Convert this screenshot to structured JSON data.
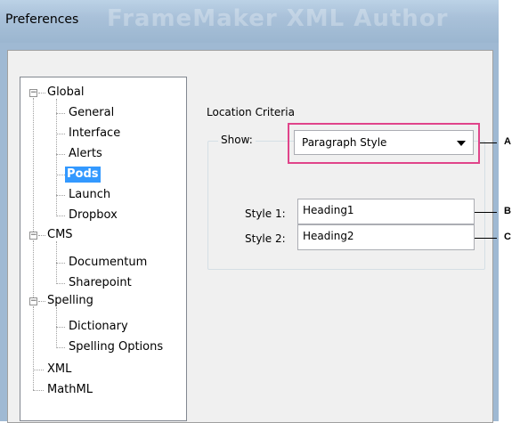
{
  "window": {
    "title": "Preferences",
    "background_title": "FrameMaker XML Author"
  },
  "tree": [
    {
      "label": "Global",
      "expanded": true
    },
    {
      "label": "General"
    },
    {
      "label": "Interface"
    },
    {
      "label": "Alerts"
    },
    {
      "label": "Pods",
      "selected": true
    },
    {
      "label": "Launch"
    },
    {
      "label": "Dropbox"
    },
    {
      "label": "CMS",
      "expanded": true
    },
    {
      "label": "Documentum"
    },
    {
      "label": "Sharepoint"
    },
    {
      "label": "Spelling",
      "expanded": true
    },
    {
      "label": "Dictionary"
    },
    {
      "label": "Spelling Options"
    },
    {
      "label": "XML"
    },
    {
      "label": "MathML"
    }
  ],
  "content": {
    "section_label": "Location Criteria",
    "show_label": "Show:",
    "show_value": "Paragraph Style",
    "style1_label": "Style 1:",
    "style1_value": "Heading1",
    "style2_label": "Style 2:",
    "style2_value": "Heading2"
  },
  "callouts": {
    "a": "A",
    "b": "B",
    "c": "C"
  },
  "colors": {
    "highlight": "#e0448a",
    "selection": "#3399ff"
  }
}
